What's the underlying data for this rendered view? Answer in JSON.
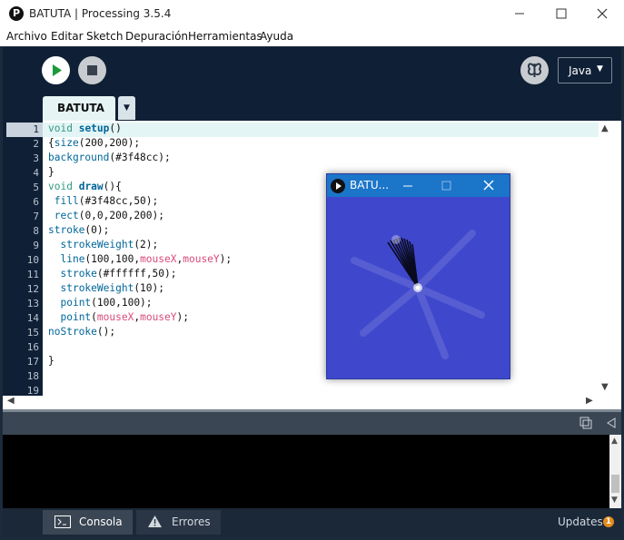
{
  "window": {
    "title": "BATUTA | Processing 3.5.4"
  },
  "menu": {
    "items": [
      "Archivo",
      "Editar",
      "Sketch",
      "Depuración",
      "Herramientas",
      "Ayuda"
    ]
  },
  "toolbar": {
    "mode": "Java"
  },
  "tabs": [
    {
      "label": "BATUTA",
      "active": true
    }
  ],
  "editor": {
    "line_numbers": [
      "1",
      "2",
      "3",
      "4",
      "5",
      "6",
      "7",
      "8",
      "9",
      "10",
      "11",
      "12",
      "13",
      "14",
      "15",
      "16",
      "17",
      "18",
      "19"
    ],
    "active_line": 1,
    "lines": [
      "void setup()",
      "{size(200,200);",
      "background(#3f48cc);",
      "}",
      "void draw(){",
      " fill(#3f48cc,50);",
      " rect(0,0,200,200);",
      "stroke(0);",
      "  strokeWeight(2);",
      "  line(100,100,mouseX,mouseY);",
      "  stroke(#ffffff,50);",
      "  strokeWeight(10);",
      "  point(100,100);",
      "  point(mouseX,mouseY);",
      "noStroke();",
      "",
      "}",
      "",
      ""
    ]
  },
  "console": {
    "tabs": [
      {
        "label": "Consola",
        "icon": "console-icon",
        "active": true
      },
      {
        "label": "Errores",
        "icon": "warning-icon",
        "active": false
      }
    ],
    "updates_label": "Updates",
    "updates_count": "1"
  },
  "sketch_window": {
    "title": "BATU...",
    "background": "#3f48cc"
  },
  "colors": {
    "toolbar_bg": "#0f2036",
    "editor_bg": "#ffffff",
    "active_line_bg": "#e4f5f6",
    "sketch_bg": "#3f48cc",
    "sketch_titlebar": "#1b75c9",
    "keyword": "#33997e",
    "function": "#006699",
    "variable": "#d94a7a"
  }
}
